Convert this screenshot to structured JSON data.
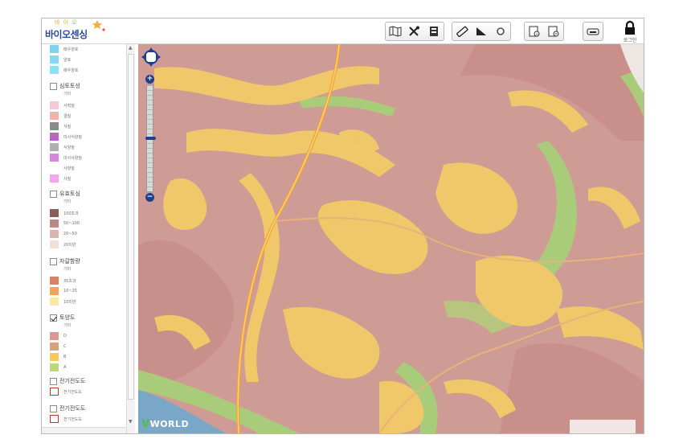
{
  "logo": {
    "small_text": "바 이 오",
    "main_text": "바이오센싱"
  },
  "toolbar": {
    "groups": [
      {
        "tools": [
          "map-icon",
          "tools-icon",
          "layers-icon"
        ]
      },
      {
        "tools": [
          "ruler-icon",
          "area-icon",
          "circle-icon"
        ]
      },
      {
        "tools": [
          "report-icon",
          "report-alt-icon"
        ]
      },
      {
        "tools": [
          "print-icon"
        ]
      }
    ],
    "login_label": "로그인"
  },
  "sidebar": {
    "top_items": [
      {
        "label": "매우양호",
        "color": "#7fd3ee"
      },
      {
        "label": "양호",
        "color": "#86d9f0"
      },
      {
        "label": "매우양호",
        "color": "#8fe0f2"
      }
    ],
    "groups": [
      {
        "title": "심토토성",
        "sub": "기타",
        "checked": false,
        "items": [
          {
            "label": "사력질",
            "color": "#f7c9d6"
          },
          {
            "label": "결질",
            "color": "#f0b4a8"
          },
          {
            "label": "식질",
            "color": "#8a8a8a"
          },
          {
            "label": "미사식양질",
            "color": "#b766c5"
          },
          {
            "label": "식양질",
            "color": "#b0b0b0"
          },
          {
            "label": "미사사양질",
            "color": "#d48ad8"
          },
          {
            "label": "사양질",
            "color": "#ffffff"
          },
          {
            "label": "사질",
            "color": "#f3a6ec"
          }
        ]
      },
      {
        "title": "유효토심",
        "sub": "기타",
        "checked": false,
        "items": [
          {
            "label": "100초과",
            "color": "#8b5e57"
          },
          {
            "label": "50~100",
            "color": "#b98a82"
          },
          {
            "label": "20~50",
            "color": "#d8b5ad"
          },
          {
            "label": "20미만",
            "color": "#f2dfd8"
          }
        ]
      },
      {
        "title": "자갈함량",
        "sub": "기타",
        "checked": false,
        "items": [
          {
            "label": "35초과",
            "color": "#d98068"
          },
          {
            "label": "10~35",
            "color": "#f3a45a"
          },
          {
            "label": "10미만",
            "color": "#fbe8a6"
          }
        ]
      },
      {
        "title": "토양도",
        "sub": "기타",
        "checked": true,
        "items": [
          {
            "label": "D",
            "color": "#d99a96"
          },
          {
            "label": "C",
            "color": "#d7a27a"
          },
          {
            "label": "B",
            "color": "#f5c860"
          },
          {
            "label": "A",
            "color": "#bcd77c"
          }
        ]
      }
    ],
    "extra": [
      {
        "title": "전기전도도",
        "item_label": "전기전도도"
      },
      {
        "title": "전기전도도",
        "item_label": "전기전도도"
      }
    ]
  },
  "map": {
    "brand": "WORLD",
    "brand_v": "V",
    "colors": {
      "base": "#cf9c95",
      "yellow": "#f0c86a",
      "green": "#a9cc7a",
      "sea": "#7aa6c8",
      "road": "#f2a338"
    }
  }
}
